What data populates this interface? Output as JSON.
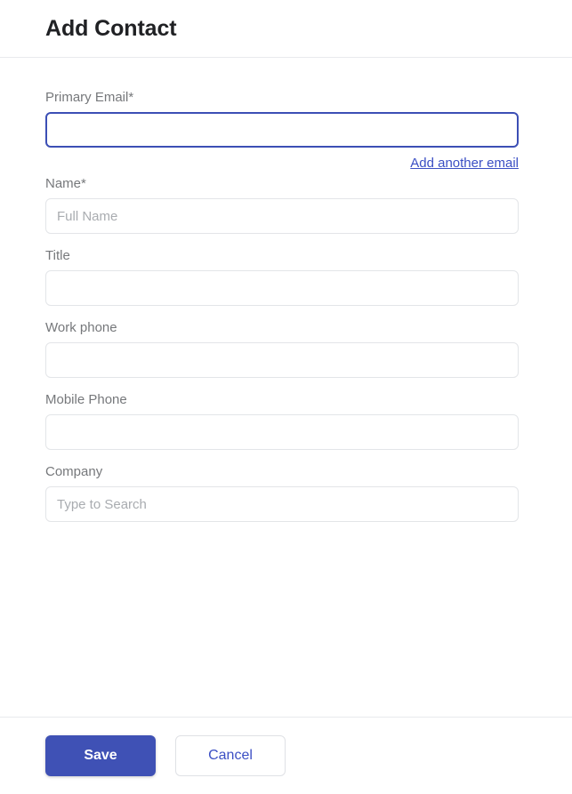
{
  "dialog": {
    "title": "Add Contact"
  },
  "form": {
    "fields": [
      {
        "key": "primary_email",
        "label": "Primary Email*",
        "value": "",
        "placeholder": "",
        "focused": true
      },
      {
        "key": "name",
        "label": "Name*",
        "value": "",
        "placeholder": "Full Name",
        "focused": false
      },
      {
        "key": "title",
        "label": "Title",
        "value": "",
        "placeholder": "",
        "focused": false
      },
      {
        "key": "work_phone",
        "label": "Work phone",
        "value": "",
        "placeholder": "",
        "focused": false
      },
      {
        "key": "mobile_phone",
        "label": "Mobile Phone",
        "value": "",
        "placeholder": "",
        "focused": false
      },
      {
        "key": "company",
        "label": "Company",
        "value": "",
        "placeholder": "Type to Search",
        "focused": false
      }
    ],
    "add_another_email_link": "Add another email"
  },
  "footer": {
    "save_label": "Save",
    "cancel_label": "Cancel"
  },
  "colors": {
    "primary": "#3f51b5",
    "link": "#3b4fc4",
    "focus_border": "#3c4fb5",
    "label_text": "#76787b",
    "title_text": "#202124",
    "input_border": "#e3e5e8",
    "divider": "#e8eaed",
    "placeholder": "#a9acb0"
  }
}
